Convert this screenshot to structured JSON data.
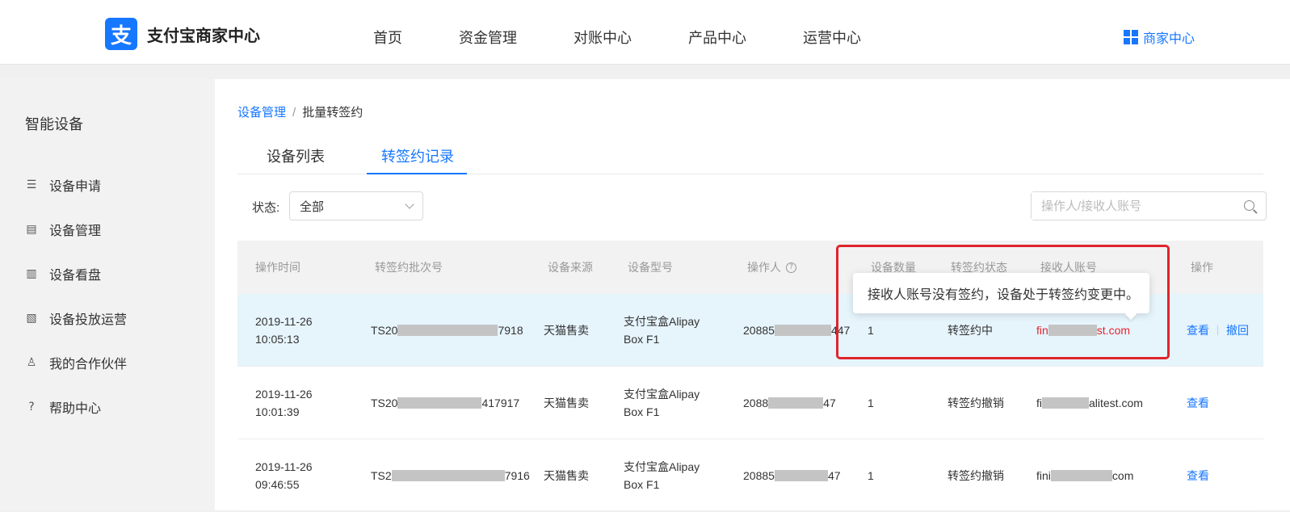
{
  "header": {
    "logo_glyph": "支",
    "logo_text": "支付宝商家中心",
    "nav": [
      "首页",
      "资金管理",
      "对账中心",
      "产品中心",
      "运营中心"
    ],
    "merchant_center": "商家中心"
  },
  "sidebar": {
    "title": "智能设备",
    "items": [
      {
        "label": "设备申请",
        "icon": "list-icon"
      },
      {
        "label": "设备管理",
        "icon": "device-doc-icon"
      },
      {
        "label": "设备看盘",
        "icon": "bar-chart-icon"
      },
      {
        "label": "设备投放运营",
        "icon": "doc-search-icon"
      },
      {
        "label": "我的合作伙伴",
        "icon": "partner-icon"
      },
      {
        "label": "帮助中心",
        "icon": "help-icon"
      }
    ]
  },
  "breadcrumb": {
    "parent": "设备管理",
    "sep": "/",
    "current": "批量转签约"
  },
  "tabs": [
    {
      "label": "设备列表",
      "active": false
    },
    {
      "label": "转签约记录",
      "active": true
    }
  ],
  "filter": {
    "label": "状态:",
    "value": "全部",
    "search_placeholder": "操作人/接收人账号"
  },
  "table": {
    "columns": [
      "操作时间",
      "转签约批次号",
      "设备来源",
      "设备型号",
      "操作人",
      "设备数量",
      "转签约状态",
      "接收人账号",
      "操作"
    ],
    "rows": [
      {
        "time_date": "2019-11-26",
        "time_clock": "10:05:13",
        "batch_pre": "TS20",
        "batch_post": "7918",
        "source": "天猫售卖",
        "model_l1": "支付宝盒Alipay",
        "model_l2": "Box F1",
        "op_pre": "20885",
        "op_post": "447",
        "count": "1",
        "status": "转签约中",
        "recv_pre": "fin",
        "recv_post": "st.com",
        "actions": [
          "查看",
          "撤回"
        ]
      },
      {
        "time_date": "2019-11-26",
        "time_clock": "10:01:39",
        "batch_pre": "TS20",
        "batch_post": "417917",
        "source": "天猫售卖",
        "model_l1": "支付宝盒Alipay",
        "model_l2": "Box F1",
        "op_pre": "2088",
        "op_post": "47",
        "count": "1",
        "status": "转签约撤销",
        "recv_pre": "fi",
        "recv_post": "alitest.com",
        "actions": [
          "查看"
        ]
      },
      {
        "time_date": "2019-11-26",
        "time_clock": "09:46:55",
        "batch_pre": "TS2",
        "batch_post": "7916",
        "source": "天猫售卖",
        "model_l1": "支付宝盒Alipay",
        "model_l2": "Box F1",
        "op_pre": "20885",
        "op_post": "47",
        "count": "1",
        "status": "转签约撤销",
        "recv_pre": "fini",
        "recv_post": "com",
        "actions": [
          "查看"
        ]
      }
    ]
  },
  "tooltip": "接收人账号没有签约，设备处于转签约变更中。",
  "colors": {
    "accent": "#1677ff",
    "highlight_row": "#e6f4fc",
    "alert_red": "#e0242c"
  }
}
